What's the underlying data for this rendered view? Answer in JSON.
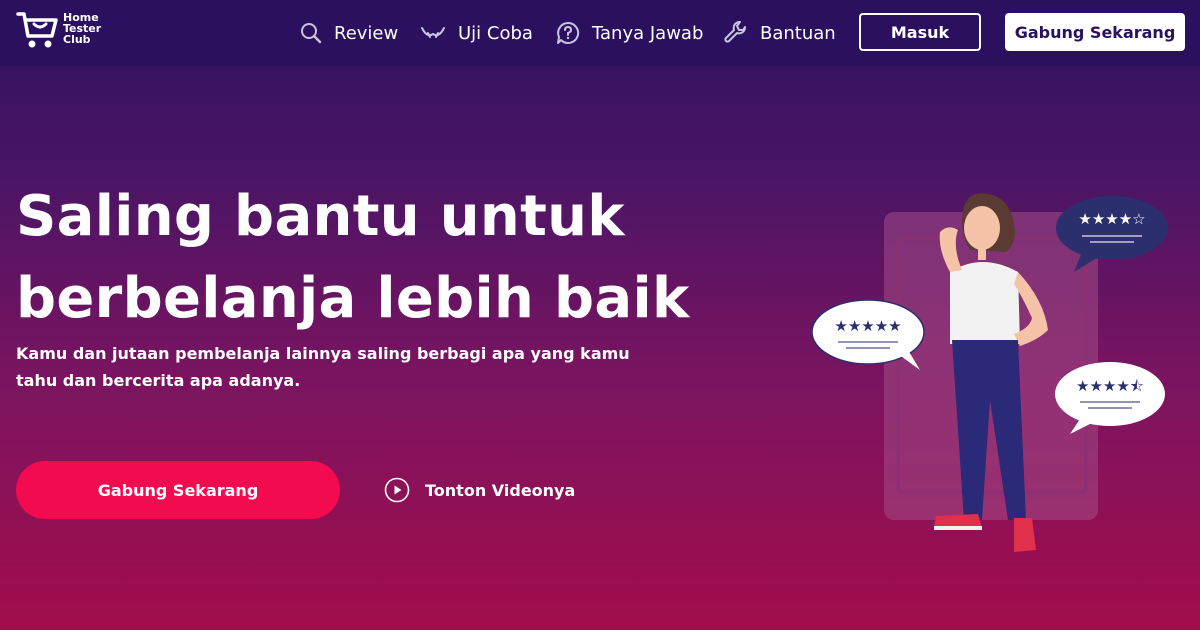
{
  "brand": {
    "name_lines": [
      "Home",
      "Tester",
      "Club"
    ],
    "logo_icon": "shopping-cart-icon"
  },
  "nav": {
    "items": [
      {
        "label": "Review",
        "icon": "search-icon"
      },
      {
        "label": "Uji Coba",
        "icon": "tester-icon"
      },
      {
        "label": "Tanya Jawab",
        "icon": "question-chat-icon"
      },
      {
        "label": "Bantuan",
        "icon": "wrench-icon"
      }
    ],
    "login_label": "Masuk",
    "join_label": "Gabung Sekarang"
  },
  "hero": {
    "headline_lines": [
      "Saling bantu untuk",
      "berbelanja lebih baik"
    ],
    "subtext": "Kamu dan jutaan pembelanja lainnya saling berbagi apa yang kamu tahu dan bercerita apa adanya.",
    "cta_label": "Gabung Sekarang",
    "video_label": "Tonton Videonya",
    "video_icon": "play-circle-icon"
  },
  "illustration": {
    "ratings": [
      {
        "filled": 4,
        "total": 5
      },
      {
        "filled": 5,
        "total": 5
      },
      {
        "filled": 4.5,
        "total": 5
      }
    ]
  },
  "colors": {
    "nav_bg": "#2b1060",
    "cta_bg": "#f20b4f",
    "gradient_top": "#2e1160",
    "gradient_bottom": "#a30d4c",
    "star_color": "#2b2f6e"
  }
}
